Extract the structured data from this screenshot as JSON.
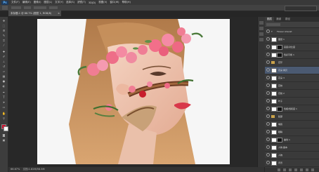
{
  "app": {
    "logo": "Ps"
  },
  "menu": [
    "文件(F)",
    "编辑(E)",
    "图像(I)",
    "图层(L)",
    "文字(Y)",
    "选择(S)",
    "滤镜(T)",
    "3D(D)",
    "视图(V)",
    "窗口(W)",
    "帮助(H)"
  ],
  "document": {
    "tab_label": "未标题-1 @ 66.7% (图层 1, RGB/8)",
    "close": "×",
    "caption": "钢笔抠图 工具 人物抠图换头"
  },
  "status": {
    "zoom": "66.67%",
    "doc_info": "文档:1.82M/56.5M"
  },
  "layers_panel": {
    "tabs": [
      "图层",
      "通道",
      "路径"
    ],
    "rows": [
      {
        "name": "Flower Alrecat",
        "type": "text",
        "selected": false
      },
      {
        "name": "图层 1",
        "type": "pixel",
        "selected": false
      },
      {
        "name": "亮度/对比度",
        "type": "adjust",
        "selected": false
      },
      {
        "name": "色彩平衡 1",
        "type": "adjust",
        "selected": false
      },
      {
        "name": "花环",
        "type": "group",
        "selected": false
      },
      {
        "name": "花朵 拷贝",
        "type": "pixel",
        "selected": true
      },
      {
        "name": "花朵 3",
        "type": "pixel",
        "selected": false
      },
      {
        "name": "花枝",
        "type": "pixel",
        "selected": false
      },
      {
        "name": "花枝 2",
        "type": "pixel",
        "selected": false
      },
      {
        "name": "叶子",
        "type": "pixel",
        "selected": false
      },
      {
        "name": "色相/饱和度 1",
        "type": "adjust",
        "selected": false
      },
      {
        "name": "脸部",
        "type": "group",
        "selected": false
      },
      {
        "name": "嘴唇",
        "type": "pixel",
        "selected": false
      },
      {
        "name": "眼睛",
        "type": "pixel",
        "selected": false
      },
      {
        "name": "曲线 1",
        "type": "adjust",
        "selected": false
      },
      {
        "name": "人物 副本",
        "type": "pixel",
        "selected": false
      },
      {
        "name": "人物",
        "type": "pixel",
        "selected": false
      },
      {
        "name": "背景",
        "type": "pixel",
        "selected": false
      }
    ]
  },
  "colors": {
    "foreground": "#c8102e",
    "background": "#ffffff",
    "selection": "#4b5a72"
  }
}
